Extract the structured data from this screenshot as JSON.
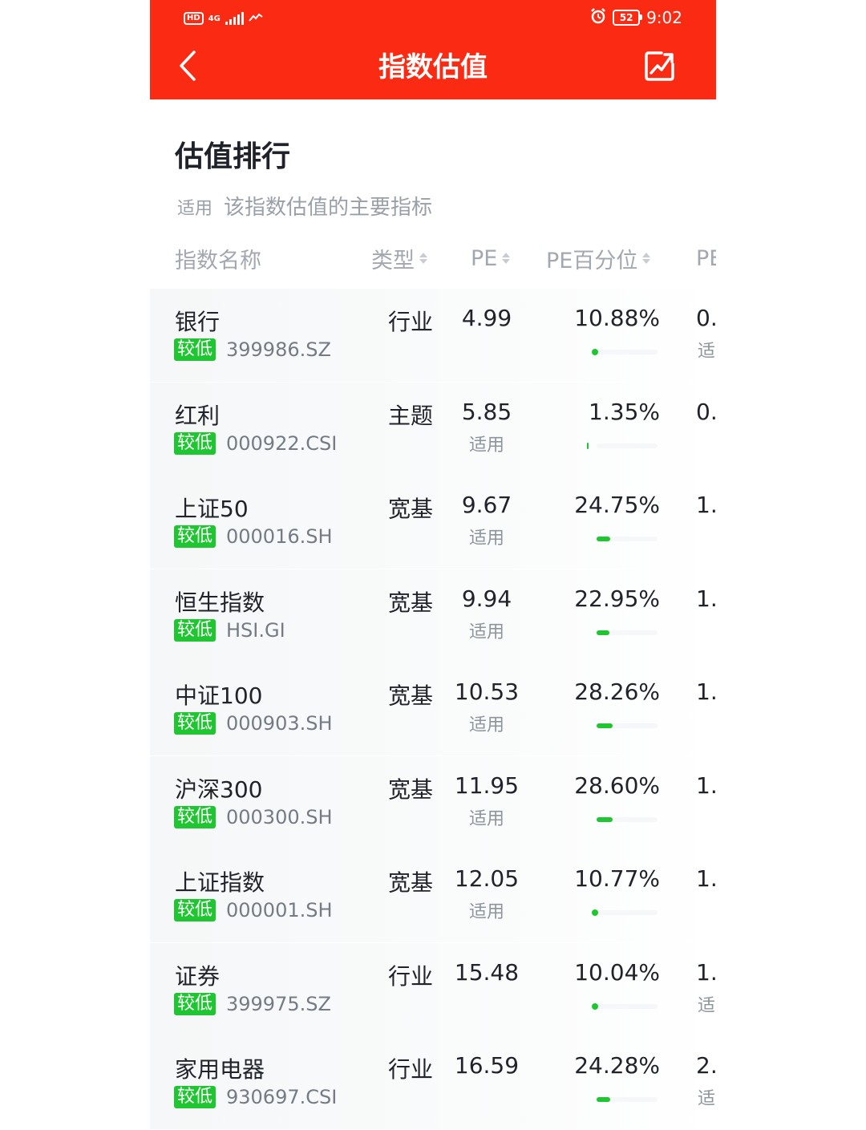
{
  "status_bar": {
    "hd": "HD",
    "network": "4G",
    "time": "9:02",
    "battery": "52"
  },
  "header": {
    "title": "指数估值",
    "bg_color": "#fb2a12",
    "back_icon": "chevron-left-icon",
    "share_icon": "share-chart-icon"
  },
  "section": {
    "title": "估值排行",
    "subtitle_tag": "适用",
    "subtitle_text": "该指数估值的主要指标"
  },
  "columns": {
    "name": "指数名称",
    "type": "类型",
    "pe": "PE",
    "pe_pct": "PE百分位",
    "pb": "PE"
  },
  "accent_green": "#20c631",
  "rows": [
    {
      "name": "银行",
      "badge": "较低",
      "code": "399986.SZ",
      "type": "行业",
      "pe": "4.99",
      "pe_sub": "",
      "pct": "10.88%",
      "pct_value": 10.88,
      "pb": "0.",
      "pb_sub": "适"
    },
    {
      "name": "红利",
      "badge": "较低",
      "code": "000922.CSI",
      "type": "主题",
      "pe": "5.85",
      "pe_sub": "适用",
      "pct": "1.35%",
      "pct_value": 1.35,
      "pb": "0.",
      "pb_sub": ""
    },
    {
      "name": "上证50",
      "badge": "较低",
      "code": "000016.SH",
      "type": "宽基",
      "pe": "9.67",
      "pe_sub": "适用",
      "pct": "24.75%",
      "pct_value": 24.75,
      "pb": "1.",
      "pb_sub": ""
    },
    {
      "name": "恒生指数",
      "badge": "较低",
      "code": "HSI.GI",
      "type": "宽基",
      "pe": "9.94",
      "pe_sub": "适用",
      "pct": "22.95%",
      "pct_value": 22.95,
      "pb": "1.",
      "pb_sub": ""
    },
    {
      "name": "中证100",
      "badge": "较低",
      "code": "000903.SH",
      "type": "宽基",
      "pe": "10.53",
      "pe_sub": "适用",
      "pct": "28.26%",
      "pct_value": 28.26,
      "pb": "1.",
      "pb_sub": ""
    },
    {
      "name": "沪深300",
      "badge": "较低",
      "code": "000300.SH",
      "type": "宽基",
      "pe": "11.95",
      "pe_sub": "适用",
      "pct": "28.60%",
      "pct_value": 28.6,
      "pb": "1.",
      "pb_sub": ""
    },
    {
      "name": "上证指数",
      "badge": "较低",
      "code": "000001.SH",
      "type": "宽基",
      "pe": "12.05",
      "pe_sub": "适用",
      "pct": "10.77%",
      "pct_value": 10.77,
      "pb": "1.",
      "pb_sub": ""
    },
    {
      "name": "证券",
      "badge": "较低",
      "code": "399975.SZ",
      "type": "行业",
      "pe": "15.48",
      "pe_sub": "",
      "pct": "10.04%",
      "pct_value": 10.04,
      "pb": "1.",
      "pb_sub": "适"
    },
    {
      "name": "家用电器",
      "badge": "较低",
      "code": "930697.CSI",
      "type": "行业",
      "pe": "16.59",
      "pe_sub": "",
      "pct": "24.28%",
      "pct_value": 24.28,
      "pb": "2.",
      "pb_sub": "适"
    }
  ]
}
